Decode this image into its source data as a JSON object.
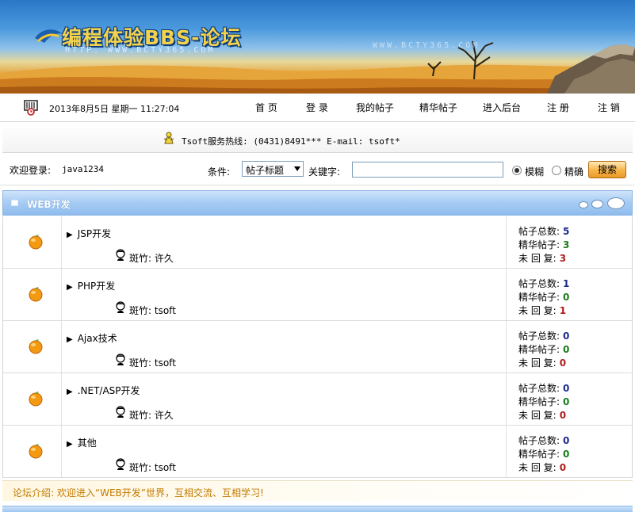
{
  "banner": {
    "title": "编程体验BBS-论坛",
    "url": "HTTP. WWW.BCTY365.COM",
    "url_faded": "WWW.BCTY365.COM"
  },
  "nav": {
    "datetime": "2013年8月5日 星期一 11:27:04",
    "items": [
      "首 页",
      "登 录",
      "我的帖子",
      "精华帖子",
      "进入后台",
      "注 册",
      "注 销"
    ]
  },
  "hotline": {
    "text": "Tsoft服务热线: (0431)8491*** E-mail: tsoft***@"
  },
  "search": {
    "welcome_label": "欢迎登录:",
    "username": "java1234",
    "condition_label": "条件:",
    "condition_value": "帖子标题",
    "keyword_label": "关键字:",
    "keyword_value": "",
    "radio_fuzzy": "模糊",
    "radio_exact": "精确",
    "button": "搜索"
  },
  "board": {
    "title": "WEB开发",
    "moderator_label": "斑竹:",
    "stat_labels": {
      "total": "帖子总数:",
      "elite": "精华帖子:",
      "unreplied": "未 回 复:"
    },
    "forums": [
      {
        "name": "JSP开发",
        "moderator": "许久",
        "total": "5",
        "elite": "3",
        "unreplied": "3"
      },
      {
        "name": "PHP开发",
        "moderator": "tsoft",
        "total": "1",
        "elite": "0",
        "unreplied": "1"
      },
      {
        "name": "Ajax技术",
        "moderator": "tsoft",
        "total": "0",
        "elite": "0",
        "unreplied": "0"
      },
      {
        "name": ".NET/ASP开发",
        "moderator": "许久",
        "total": "0",
        "elite": "0",
        "unreplied": "0"
      },
      {
        "name": "其他",
        "moderator": "tsoft",
        "total": "0",
        "elite": "0",
        "unreplied": "0"
      }
    ],
    "intro": "论坛介绍: 欢迎进入“WEB开发”世界，互相交流、互相学习!"
  },
  "colors": {
    "accent_blue": "#8fbcee",
    "intro_orange": "#c27a00",
    "count_blue": "#1c2a8a",
    "count_green": "#187a18",
    "count_red": "#b01c1c"
  }
}
